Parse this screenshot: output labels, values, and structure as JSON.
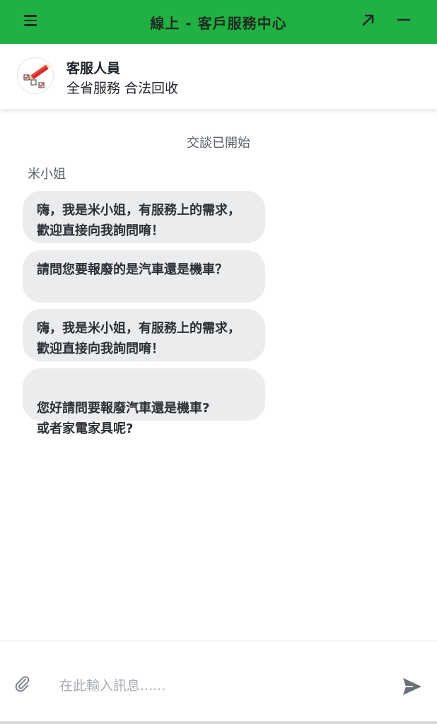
{
  "header": {
    "title": "線上 - 客戶服務中心",
    "menu_icon": "hamburger-menu-icon",
    "expand_icon": "expand-arrow-icon",
    "minimize_icon": "minimize-icon",
    "bg_color": "#20b043"
  },
  "agent": {
    "name": "客服人員",
    "subtitle": "全省服務 合法回收",
    "avatar_icon": "pencil-checklist-icon"
  },
  "chat": {
    "system_message": "交談已開始",
    "sender_name": "米小姐",
    "messages": [
      {
        "text": "嗨，我是米小姐，有服務上的需求，歡迎直接向我詢問唷！"
      },
      {
        "text": "請問您要報廢的是汽車還是機車？"
      },
      {
        "text": "嗨，我是米小姐，有服務上的需求，歡迎直接向我詢問唷！"
      },
      {
        "text": "您好請問要報廢汽車還是機車?\n或者家電家具呢?"
      }
    ]
  },
  "composer": {
    "placeholder": "在此輸入訊息......",
    "value": "",
    "attach_icon": "paperclip-icon",
    "send_icon": "send-icon"
  }
}
